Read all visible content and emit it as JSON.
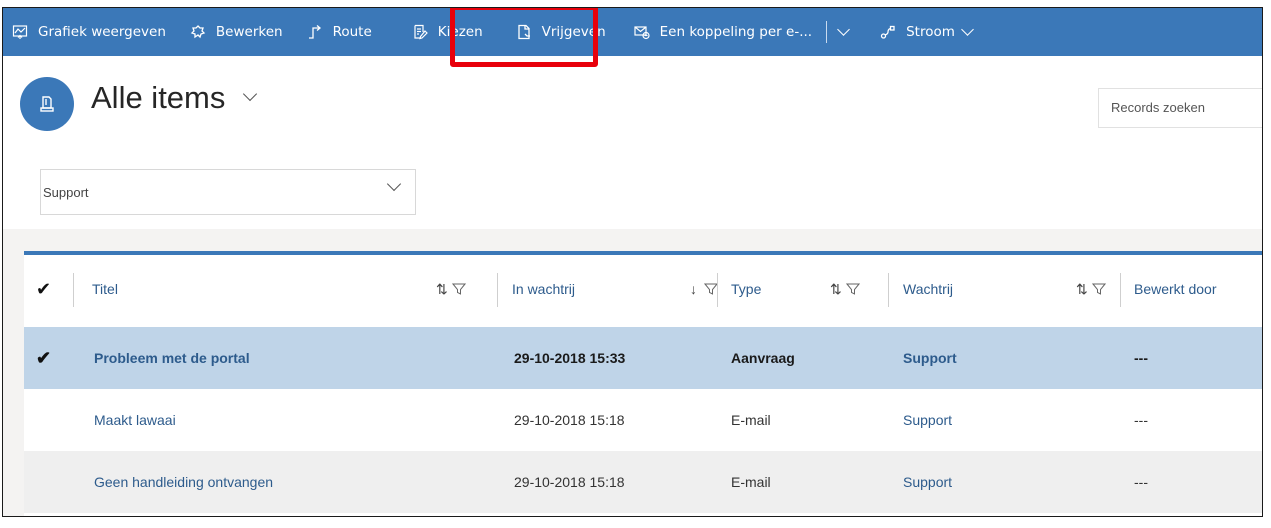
{
  "toolbar": {
    "items": [
      {
        "label": "Grafiek weergeven",
        "icon": "chart-icon"
      },
      {
        "label": "Bewerken",
        "icon": "edit-icon"
      },
      {
        "label": "Route",
        "icon": "route-icon"
      },
      {
        "label": "Kiezen",
        "icon": "pick-icon"
      },
      {
        "label": "Vrijgeven",
        "icon": "release-icon"
      },
      {
        "label": "Een koppeling per e-...",
        "icon": "email-link-icon"
      }
    ],
    "flow_label": "Stroom",
    "highlighted_item": "Kiezen",
    "highlight_color": "#e8000b",
    "bar_color": "#3b78b8"
  },
  "header": {
    "title": "Alle items",
    "search_placeholder": "Records zoeken",
    "view_selector": "Support"
  },
  "grid": {
    "columns": [
      {
        "label": "Titel",
        "sort": "both"
      },
      {
        "label": "In wachtrij",
        "sort": "desc"
      },
      {
        "label": "Type",
        "sort": "both"
      },
      {
        "label": "Wachtrij",
        "sort": "both"
      },
      {
        "label": "Bewerkt door",
        "sort": "none"
      }
    ],
    "rows": [
      {
        "selected": true,
        "title": "Probleem met de portal",
        "in_queue": "29-10-2018 15:33",
        "type": "Aanvraag",
        "queue": "Support",
        "worked_by": "---"
      },
      {
        "selected": false,
        "title": "Maakt lawaai",
        "in_queue": "29-10-2018 15:18",
        "type": "E-mail",
        "queue": "Support",
        "worked_by": "---"
      },
      {
        "selected": false,
        "title": "Geen handleiding ontvangen",
        "in_queue": "29-10-2018 15:18",
        "type": "E-mail",
        "queue": "Support",
        "worked_by": "---"
      }
    ]
  }
}
